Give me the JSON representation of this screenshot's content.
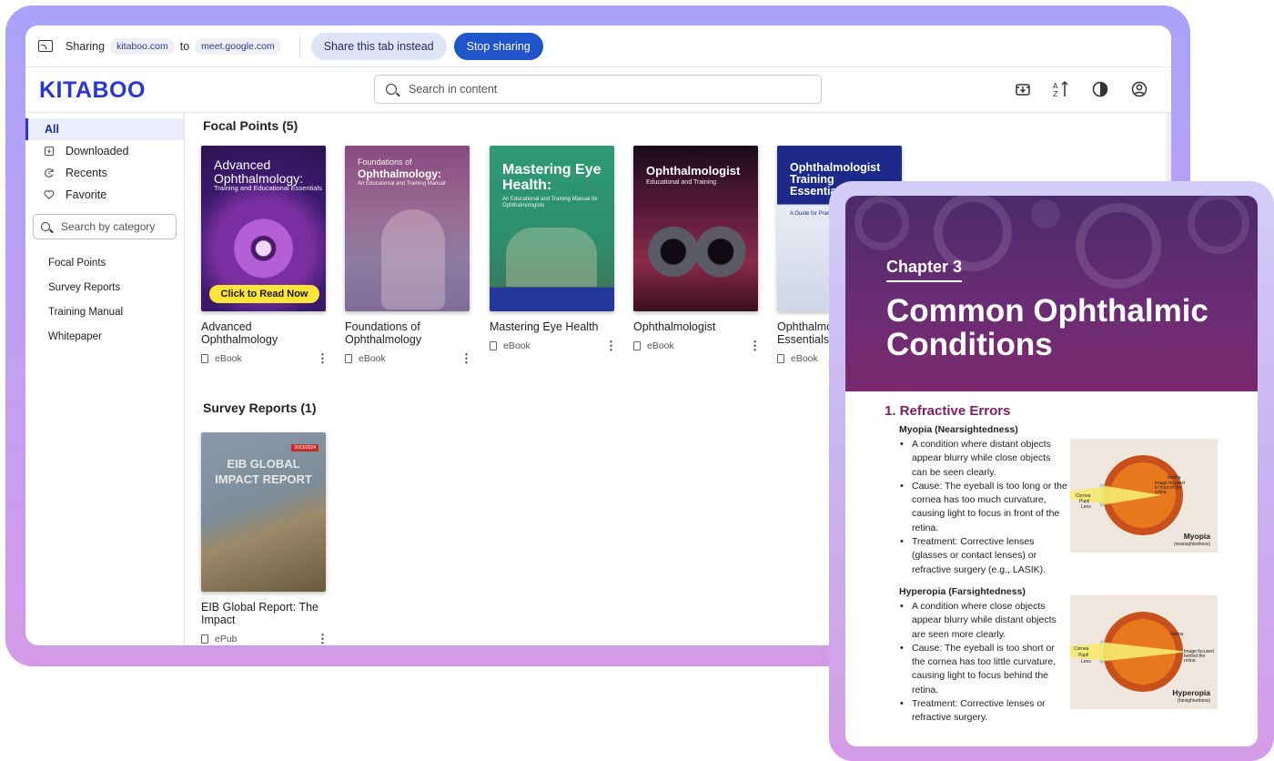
{
  "share_bar": {
    "sharing_label": "Sharing",
    "source_chip": "kitaboo.com",
    "to_label": "to",
    "target_chip": "meet.google.com",
    "share_tab_button": "Share this tab instead",
    "stop_button": "Stop sharing"
  },
  "header": {
    "logo": "KITABOO",
    "search_placeholder": "Search in content",
    "icons": [
      "download-icon",
      "sort-az-icon",
      "contrast-icon",
      "account-icon"
    ]
  },
  "sidebar": {
    "nav": [
      {
        "label": "All",
        "icon": ""
      },
      {
        "label": "Downloaded",
        "icon": "download-icon"
      },
      {
        "label": "Recents",
        "icon": "recent-icon"
      },
      {
        "label": "Favorite",
        "icon": "heart-icon"
      }
    ],
    "category_search_placeholder": "Search by category",
    "categories": [
      "Focal Points",
      "Survey Reports",
      "Training Manual",
      "Whitepaper"
    ]
  },
  "main": {
    "sections": [
      {
        "title": "Focal Points (5)",
        "books": [
          {
            "cover_title": "Advanced Ophthalmology:",
            "cover_sub": "Training and Educational Essentials",
            "cta": "Click to Read Now",
            "title": "Advanced Ophthalmology",
            "type": "eBook"
          },
          {
            "cover_kicker": "Foundations of",
            "cover_title": "Ophthalmology:",
            "cover_sub": "An Educational and Training Manual",
            "title": "Foundations of Ophthalmology",
            "type": "eBook"
          },
          {
            "cover_title": "Mastering Eye Health:",
            "cover_sub": "An Educational and Training Manual for Ophthalmologists",
            "title": "Mastering Eye Health",
            "type": "eBook"
          },
          {
            "cover_title": "Ophthalmologist",
            "cover_sub": "Educational and Training",
            "title": "Ophthalmologist",
            "type": "eBook"
          },
          {
            "cover_title": "Ophthalmologist Training Essentials:",
            "cover_sub": "A Guide for Practitioners",
            "title": "Ophthalmologist Training Essentials",
            "type": "eBook"
          }
        ]
      },
      {
        "title": "Survey Reports (1)",
        "books": [
          {
            "cover_badge": "2023/2024",
            "cover_title": "EIB GLOBAL IMPACT REPORT",
            "title": "EIB Global Report: The Impact",
            "type": "ePub"
          }
        ]
      }
    ]
  },
  "reader": {
    "chapter": "Chapter 3",
    "title": "Common Ophthalmic Conditions",
    "section": "1. Refractive Errors",
    "conditions": [
      {
        "name": "Myopia (Nearsightedness)",
        "points": [
          "A condition where distant objects appear blurry while close objects can be seen clearly.",
          "Cause: The eyeball is too long or the cornea has too much curvature, causing light to focus in front of the retina.",
          "Treatment: Corrective lenses (glasses or contact lenses) or refractive surgery (e.g., LASIK)."
        ],
        "figure": {
          "caption": "Myopia",
          "caption_sub": "(nearsightedness)",
          "labels": [
            "Retina",
            "Cornea",
            "Pupil",
            "Lens",
            "Image focused in front of the retina"
          ]
        }
      },
      {
        "name": "Hyperopia (Farsightedness)",
        "points": [
          "A condition where close objects appear blurry while distant objects are seen more clearly.",
          "Cause: The eyeball is too short or the cornea has too little curvature, causing light to focus behind the retina.",
          "Treatment: Corrective lenses or refractive surgery."
        ],
        "figure": {
          "caption": "Hyperopia",
          "caption_sub": "(farsightedness)",
          "labels": [
            "Retina",
            "Cornea",
            "Pupil",
            "Lens",
            "Image focused behind the retina"
          ]
        }
      }
    ]
  },
  "colors": {
    "brand": "#2b35d6",
    "stop_button": "#1f55c9",
    "accent": "#7e1d62"
  }
}
